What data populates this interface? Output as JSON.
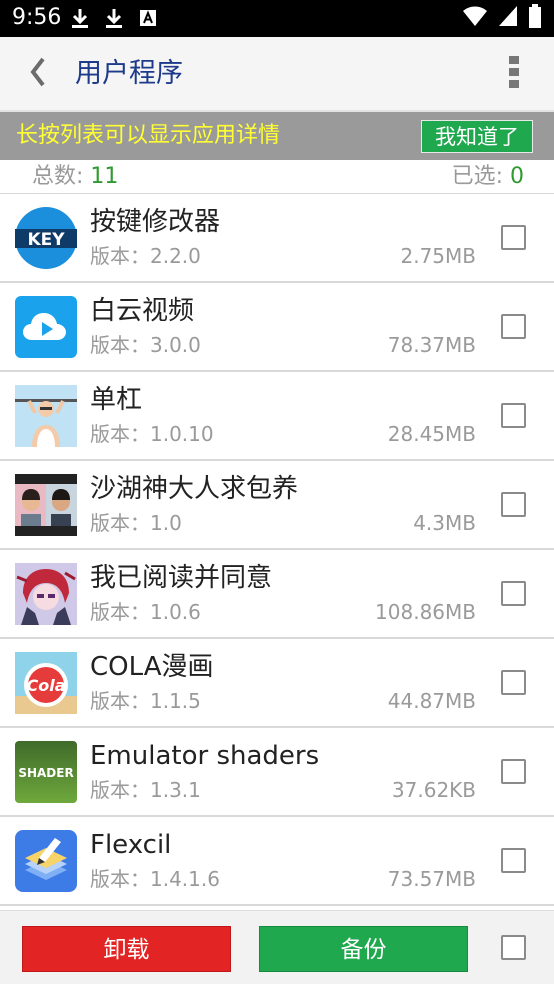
{
  "status_bar": {
    "time": "9:56",
    "icons": [
      "download-icon",
      "download-icon",
      "a-notification-icon",
      "wifi-icon",
      "signal-icon",
      "battery-icon"
    ]
  },
  "header": {
    "title": "用户程序",
    "back_icon": "chevron-left-icon",
    "menu_icon": "more-vert-icon"
  },
  "hint": {
    "text": "长按列表可以显示应用详情",
    "button_label": "我知道了"
  },
  "summary": {
    "total_label": "总数: ",
    "total_value": "11",
    "selected_label": "已选: ",
    "selected_value": "0"
  },
  "apps": [
    {
      "name": "按键修改器",
      "version": "版本：2.2.0",
      "size": "2.75MB",
      "icon": "key-app-icon",
      "checked": false
    },
    {
      "name": "白云视频",
      "version": "版本：3.0.0",
      "size": "78.37MB",
      "icon": "cloud-video-app-icon",
      "checked": false
    },
    {
      "name": "单杠",
      "version": "版本：1.0.10",
      "size": "28.45MB",
      "icon": "pullup-man-app-icon",
      "checked": false
    },
    {
      "name": "沙湖神大人求包养",
      "version": "版本：1.0",
      "size": "4.3MB",
      "icon": "two-people-photo-app-icon",
      "checked": false
    },
    {
      "name": "我已阅读并同意",
      "version": "版本：1.0.6",
      "size": "108.86MB",
      "icon": "anime-girl-app-icon",
      "checked": false
    },
    {
      "name": "COLA漫画",
      "version": "版本：1.1.5",
      "size": "44.87MB",
      "icon": "cola-logo-app-icon",
      "checked": false
    },
    {
      "name": "Emulator shaders",
      "version": "版本：1.3.1",
      "size": "37.62KB",
      "icon": "shader-app-icon",
      "checked": false
    },
    {
      "name": "Flexcil",
      "version": "版本：1.4.1.6",
      "size": "73.57MB",
      "icon": "flexcil-pen-app-icon",
      "checked": false
    }
  ],
  "icon_text": {
    "key": "KEY",
    "cola": "Cola",
    "shader": "SHADER"
  },
  "bottom": {
    "uninstall_label": "卸载",
    "backup_label": "备份"
  },
  "colors": {
    "accent_green": "#1fa84e",
    "danger_red": "#e22424",
    "title_blue": "#1e3a8a",
    "hint_yellow": "#ffff33",
    "count_green": "#2f9a2f"
  }
}
